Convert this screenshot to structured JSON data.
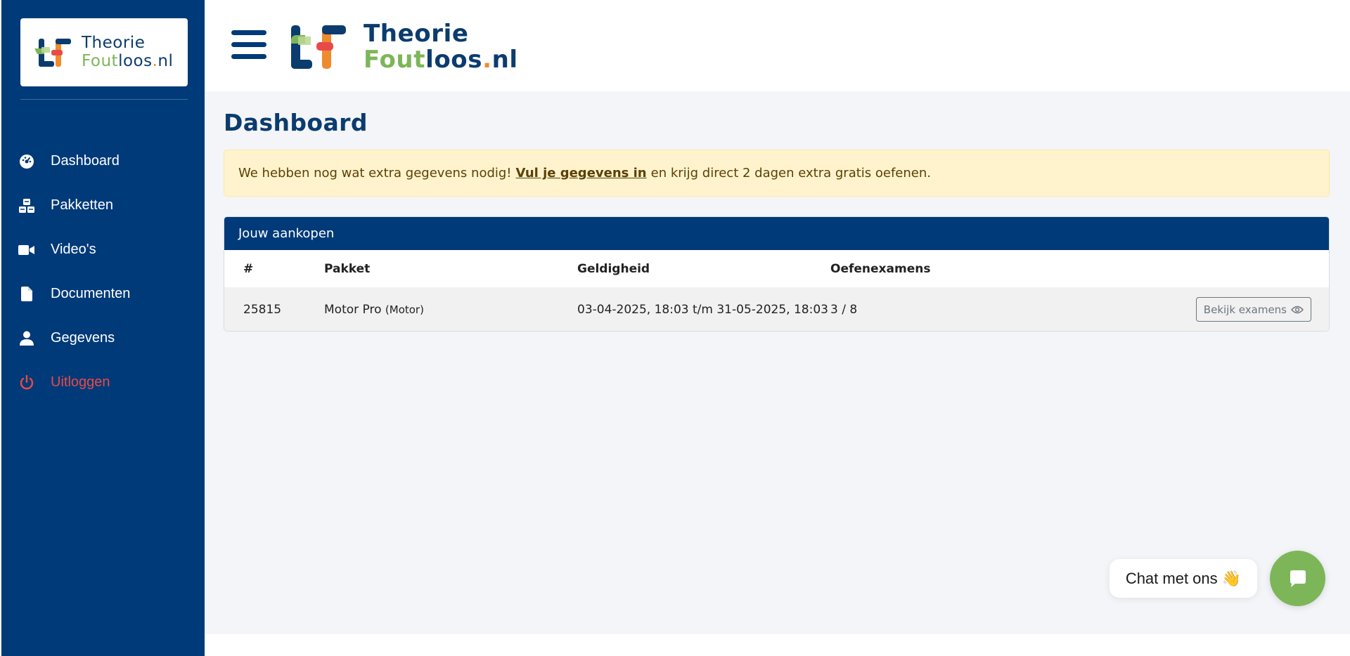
{
  "brand": {
    "line1": "Theorie",
    "line2_a": "Fout",
    "line2_b": "loos",
    "line2_dot": ".",
    "line2_c": "nl",
    "colors": {
      "dark": "#0b3c6e",
      "green": "#7db659",
      "orange": "#f08a2e",
      "red": "#e84a4a"
    }
  },
  "sidebar": {
    "background": "#003a78",
    "items": [
      {
        "label": "Dashboard",
        "icon": "speedometer-icon"
      },
      {
        "label": "Pakketten",
        "icon": "cubes-icon"
      },
      {
        "label": "Video's",
        "icon": "video-camera-icon"
      },
      {
        "label": "Documenten",
        "icon": "document-icon"
      },
      {
        "label": "Gegevens",
        "icon": "user-icon"
      },
      {
        "label": "Uitloggen",
        "icon": "power-icon"
      }
    ]
  },
  "main": {
    "title": "Dashboard",
    "alert": {
      "before": "We hebben nog wat extra gegevens nodig!",
      "link": "Vul je gegevens in",
      "after": "en krijg direct 2 dagen extra gratis oefenen."
    },
    "purchases": {
      "title": "Jouw aankopen",
      "columns": [
        "#",
        "Pakket",
        "Geldigheid",
        "Oefenexamens"
      ],
      "rows": [
        {
          "id": "25815",
          "package": "Motor Pro",
          "package_sub": "(Motor)",
          "validity": "03-04-2025, 18:03 t/m 31-05-2025, 18:03",
          "exams": "3 / 8",
          "button": "Bekijk examens"
        }
      ]
    }
  },
  "chat": {
    "label": "Chat met ons",
    "emoji": "👋"
  }
}
